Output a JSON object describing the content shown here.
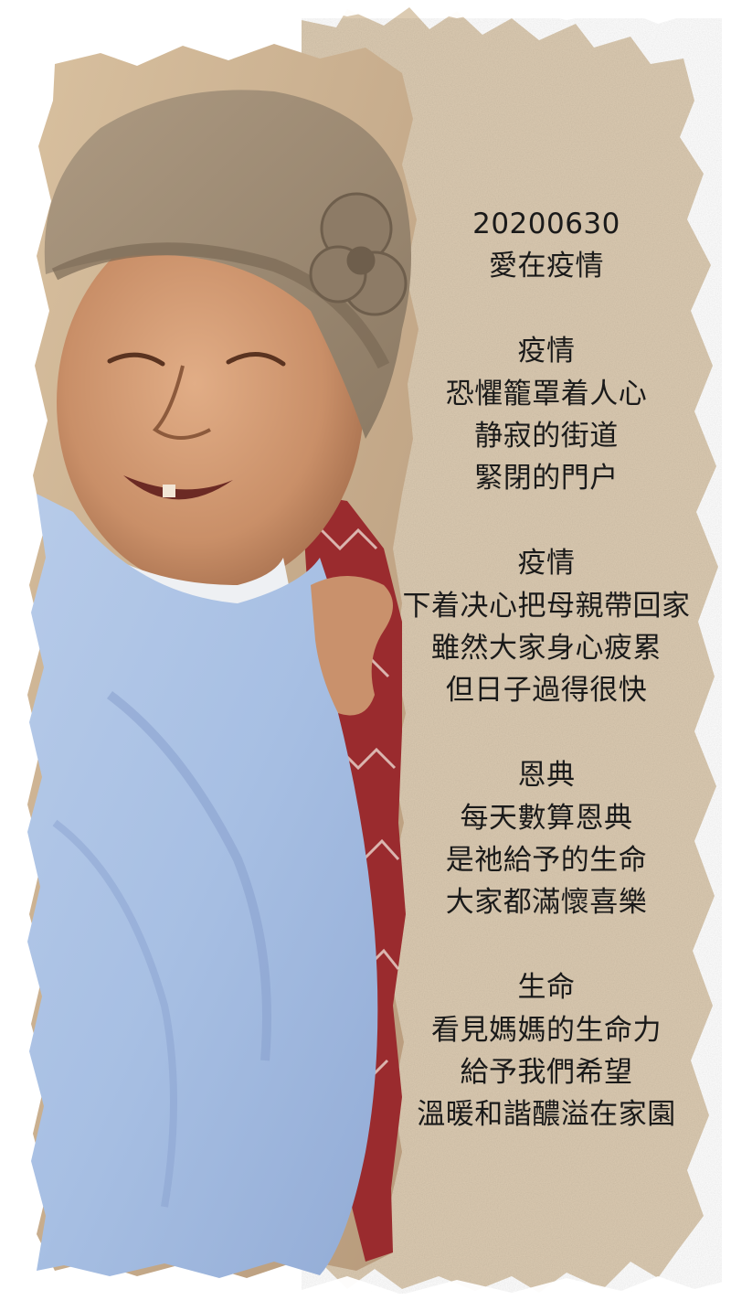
{
  "poem": {
    "date": "20200630",
    "title": "愛在疫情",
    "stanzas": [
      {
        "lines": [
          "疫情",
          "恐懼籠罩着人心",
          "静寂的街道",
          "緊閉的門户"
        ]
      },
      {
        "lines": [
          "疫情",
          "下着决心把母親帶回家",
          "雖然大家身心疲累",
          "但日子過得很快"
        ]
      },
      {
        "lines": [
          "恩典",
          "每天數算恩典",
          "是祂給予的生命",
          "大家都滿懷喜樂"
        ]
      },
      {
        "lines": [
          "生命",
          "看見媽媽的生命力",
          "給予我們希望",
          "溫暖和諧醲溢在家園"
        ]
      }
    ]
  },
  "colors": {
    "paper": "#dccbb2",
    "paper_shadow": "#cdb89a",
    "text": "#1a1a1a",
    "towel": "#a9c0e2",
    "hat": "#9c8a74",
    "skin": "#d19a73",
    "sweater": "#9a2b2e"
  }
}
